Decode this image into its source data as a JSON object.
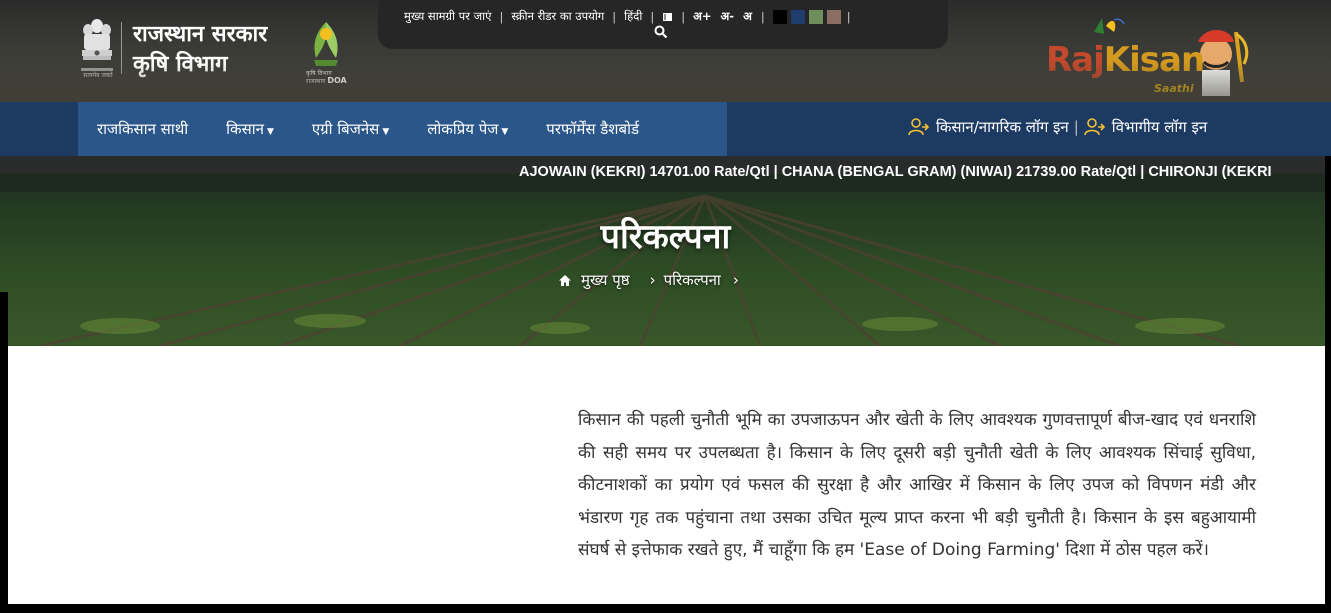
{
  "header": {
    "gov_title_line1": "राजस्थान सरकार",
    "gov_title_line2": "कृषि विभाग",
    "emblem_caption": "सत्यमेव जयते",
    "doa_label": "DOA",
    "doa_caption": "कृषि विभाग राजस्थान"
  },
  "accessibility": {
    "skip_to_content": "मुख्य सामग्री पर जाएं",
    "screen_reader": "स्क्रीन रीडर का उपयोग",
    "language": "हिंदी",
    "font_increase": "अ+",
    "font_decrease": "अ-",
    "font_normal": "अ",
    "theme_colors": [
      "#000000",
      "#1f3d6e",
      "#6f8f5a",
      "#8a6e64"
    ]
  },
  "brand": {
    "raj": "Raj",
    "kisan": "Kisan",
    "saathi": "Saathi"
  },
  "nav": {
    "items": [
      {
        "label": "राजकिसान साथी",
        "dropdown": false
      },
      {
        "label": "किसान",
        "dropdown": true
      },
      {
        "label": "एग्री बिजनेस",
        "dropdown": true
      },
      {
        "label": "लोकप्रिय पेज",
        "dropdown": true
      },
      {
        "label": "परफॉर्मेंस डैशबोर्ड",
        "dropdown": false
      }
    ],
    "farmer_login": "किसान/नागरिक लॉग इन",
    "dept_login": "विभागीय लॉग इन",
    "login_separator": "|"
  },
  "ticker": {
    "text": "AJOWAIN (KEKRI) 14701.00 Rate/Qtl | CHANA (BENGAL GRAM) (NIWAI) 21739.00 Rate/Qtl | CHIRONJI (KEKRI"
  },
  "hero": {
    "title": "परिकल्पना",
    "breadcrumb_home": "मुख्य पृष्ठ",
    "breadcrumb_current": "परिकल्पना"
  },
  "content": {
    "paragraph": "किसान की पहली चुनौती भूमि का उपजाऊपन और खेती के लिए आवश्यक गुणवत्तापूर्ण बीज-खाद एवं धनराशि की सही समय पर उपलब्धता है। किसान के लिए दूसरी बड़ी चुनौती खेती के लिए आवश्यक सिंचाई सुविधा, कीटनाशकों का प्रयोग एवं फसल की सुरक्षा है और आखिर में किसान के लिए उपज को विपणन मंडी और भंडारण गृह तक पहुंचाना तथा उसका उचित मूल्य प्राप्त करना भी बड़ी चुनौती है। किसान के इस बहुआयामी संघर्ष से इत्तेफाक रखते हुए, मैं चाहूँगा कि हम 'Ease of Doing Farming' दिशा में ठोस पहल करें।"
  }
}
